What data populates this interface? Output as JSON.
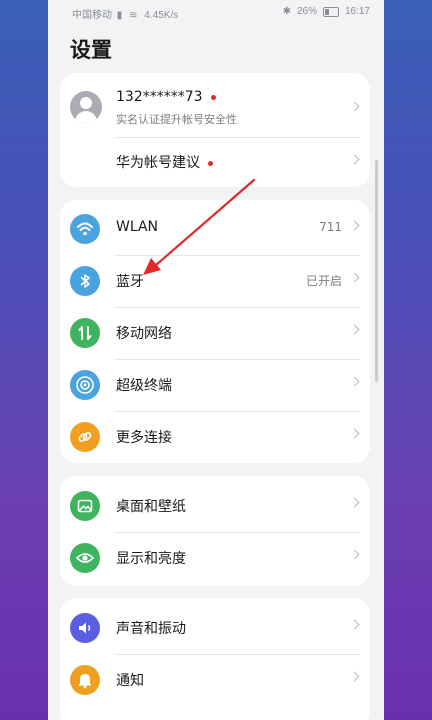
{
  "statusbar": {
    "carrier": "中国移动",
    "net_speed": "4.45K/s",
    "battery": "26%",
    "time": "16:17"
  },
  "page": {
    "title": "设置"
  },
  "account": {
    "phone": "132******73",
    "subtitle": "实名认证提升帐号安全性",
    "suggestion": "华为帐号建议"
  },
  "network": {
    "wlan": {
      "label": "WLAN",
      "value": "711"
    },
    "bluetooth": {
      "label": "蓝牙",
      "value": "已开启"
    },
    "mobile": {
      "label": "移动网络"
    },
    "super": {
      "label": "超级终端"
    },
    "more": {
      "label": "更多连接"
    }
  },
  "display": {
    "desktop": {
      "label": "桌面和壁纸"
    },
    "brightness": {
      "label": "显示和亮度"
    }
  },
  "sound": {
    "sound": {
      "label": "声音和振动"
    },
    "notify": {
      "label": "通知"
    }
  },
  "colors": {
    "wlan": "#4aa3df",
    "bluetooth": "#4aa3df",
    "mobile": "#3fb35f",
    "super": "#4aa3df",
    "more": "#f0a020",
    "desktop": "#3fb35f",
    "brightness": "#3fb35f",
    "sound": "#5a5ee0",
    "notify": "#f0a020",
    "annotation_arrow": "#e02a2a"
  },
  "icons": [
    "wifi-icon",
    "bluetooth-icon",
    "mobile-network-icon",
    "super-device-icon",
    "link-icon",
    "wallpaper-icon",
    "eye-icon",
    "speaker-icon",
    "bell-icon"
  ]
}
